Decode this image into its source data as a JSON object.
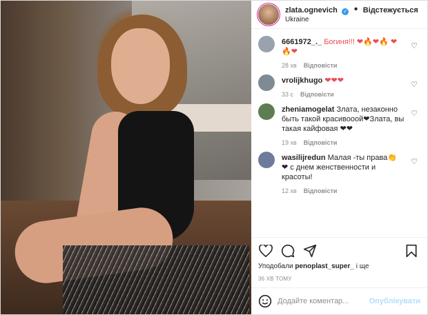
{
  "header": {
    "username": "zlata.ognevich",
    "follow_label": "Відстежується",
    "location": "Ukraine"
  },
  "comments": [
    {
      "user": "6661972_._",
      "text": "Богиня!!! ❤🔥❤🔥 ❤🔥❤",
      "time": "28 хв",
      "reply": "Відповісти",
      "avatar_color": "#9aa3ad"
    },
    {
      "user": "vrolijkhugo",
      "text": "❤❤❤",
      "time": "33 с",
      "reply": "Відповісти",
      "avatar_color": "#7e8b94"
    },
    {
      "user": "zheniamogelat",
      "text": "Злата, незаконно быть такой красивооой❤Злата, вы такая кайфовая ❤❤",
      "time": "19 хв",
      "reply": "Відповісти",
      "avatar_color": "#5e7d52"
    },
    {
      "user": "wasilijredun",
      "text": "Малая -ты права👏 ❤ с днем женственности и красоты!",
      "time": "12 хв",
      "reply": "Відповісти",
      "avatar_color": "#6d7b9c"
    }
  ],
  "actions": {
    "liked_by_prefix": "Уподобали",
    "liked_by_user": "penoplast_super_",
    "liked_by_suffix": "і ще",
    "time_ago": "36 ХВ ТОМУ"
  },
  "add_comment": {
    "placeholder": "Додайте коментар...",
    "post_label": "Опублікувати"
  },
  "colors": {
    "heart": "#ed4956",
    "link": "#3897f0",
    "post_disabled": "#b2dffc"
  }
}
